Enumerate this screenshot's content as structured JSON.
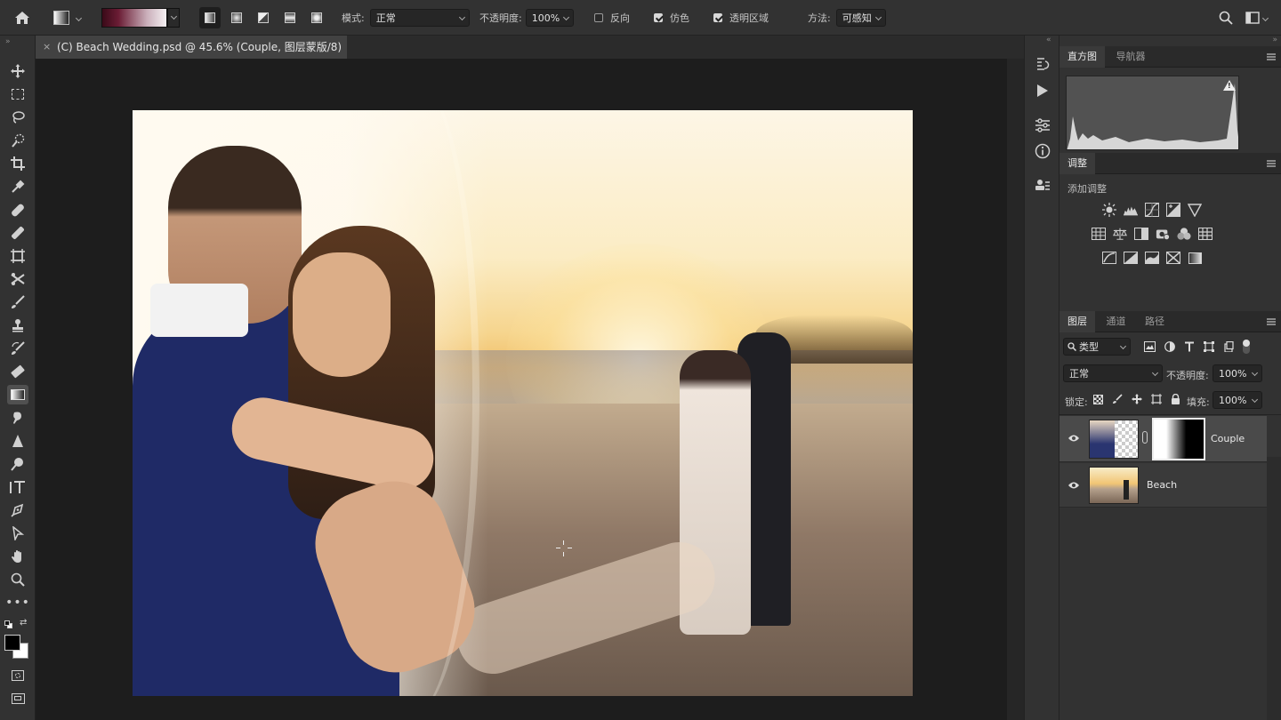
{
  "options_bar": {
    "mode_label": "模式:",
    "mode_value": "正常",
    "opacity_label": "不透明度:",
    "opacity_value": "100%",
    "reverse_label": "反向",
    "reverse_checked": false,
    "dither_label": "仿色",
    "dither_checked": true,
    "transparency_label": "透明区域",
    "transparency_checked": true,
    "method_label": "方法:",
    "method_value": "可感知"
  },
  "document": {
    "tab_title": "(C) Beach Wedding.psd @ 45.6% (Couple, 图层蒙版/8) *"
  },
  "tools": [
    "move-tool",
    "marquee-tool",
    "lasso-tool",
    "quick-select-tool",
    "crop-tool",
    "eyedropper-tool",
    "healing-tool",
    "brush-tool",
    "frame-tool",
    "pen-tool",
    "stamp-tool",
    "history-brush-tool",
    "eraser-tool",
    "gradient-tool",
    "smudge-tool",
    "sharpen-tool",
    "dodge-tool",
    "type-tool",
    "path-select-tool",
    "direct-select-tool",
    "hand-tool",
    "zoom-tool",
    "more-tools"
  ],
  "histogram_panel": {
    "tabs": [
      "直方图",
      "导航器"
    ],
    "active_tab": "直方图"
  },
  "adjustments_panel": {
    "tab": "调整",
    "subtitle": "添加调整"
  },
  "layers_panel": {
    "tabs": [
      "图层",
      "通道",
      "路径"
    ],
    "active_tab": "图层",
    "filter_label": "类型",
    "blend_mode": "正常",
    "opacity_label": "不透明度:",
    "opacity_value": "100%",
    "lock_label": "锁定:",
    "fill_label": "填充:",
    "fill_value": "100%",
    "layers": [
      {
        "name": "Couple",
        "visible": true,
        "selected": true,
        "has_mask": true
      },
      {
        "name": "Beach",
        "visible": true,
        "selected": false,
        "has_mask": false
      }
    ]
  },
  "colors": {
    "accent_selection": "#4a4a4a",
    "foreground_color": "#000000",
    "background_color": "#ffffff"
  }
}
